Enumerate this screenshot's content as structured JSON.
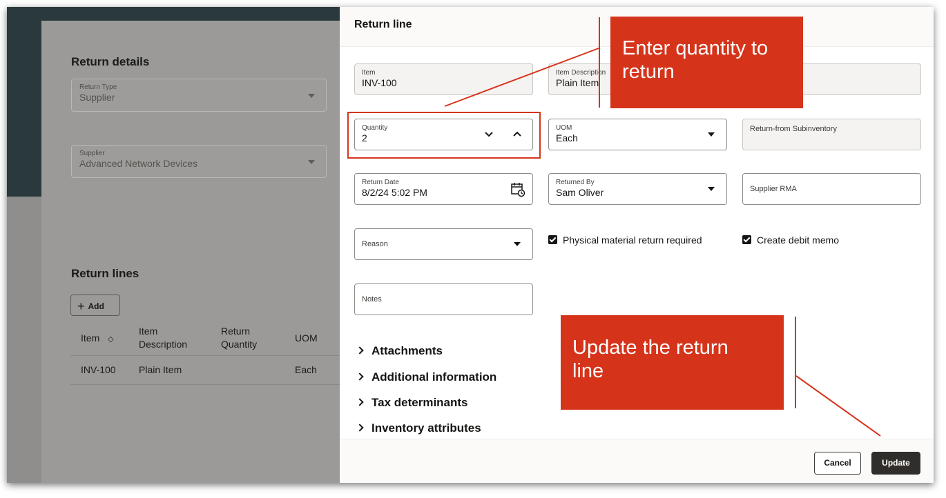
{
  "background": {
    "return_details_heading": "Return details",
    "return_type": {
      "label": "Return Type",
      "value": "Supplier"
    },
    "supplier": {
      "label": "Supplier",
      "value": "Advanced Network Devices"
    },
    "return_lines_heading": "Return lines",
    "add_button": "Add",
    "table": {
      "headers": [
        "Item",
        "Item Description",
        "Return Quantity",
        "UOM"
      ],
      "rows": [
        {
          "item": "INV-100",
          "description": "Plain Item",
          "quantity": "",
          "uom": "Each"
        }
      ]
    }
  },
  "drawer": {
    "title": "Return line",
    "item": {
      "label": "Item",
      "value": "INV-100"
    },
    "item_description": {
      "label": "Item Description",
      "value": "Plain Item"
    },
    "quantity": {
      "label": "Quantity",
      "value": "2"
    },
    "uom": {
      "label": "UOM",
      "value": "Each"
    },
    "return_from_subinventory": {
      "label": "Return-from Subinventory"
    },
    "return_date": {
      "label": "Return Date",
      "value": "8/2/24 5:02 PM"
    },
    "returned_by": {
      "label": "Returned By",
      "value": "Sam Oliver"
    },
    "supplier_rma": {
      "label": "Supplier RMA"
    },
    "reason": {
      "label": "Reason"
    },
    "notes": {
      "label": "Notes"
    },
    "physical_return": {
      "label": "Physical material return required",
      "checked": true
    },
    "create_debit_memo": {
      "label": "Create debit memo",
      "checked": true
    },
    "sections": [
      "Attachments",
      "Additional information",
      "Tax determinants",
      "Inventory attributes"
    ],
    "cancel_label": "Cancel",
    "update_label": "Update"
  },
  "callouts": {
    "quantity": {
      "line1": "Enter quantity to",
      "line2": "return"
    },
    "update": {
      "line1": "Update the return",
      "line2": "line"
    }
  },
  "colors": {
    "callout": "#d5341b",
    "primary_button": "#312d2a",
    "teal_header": "#2a3a3c"
  }
}
